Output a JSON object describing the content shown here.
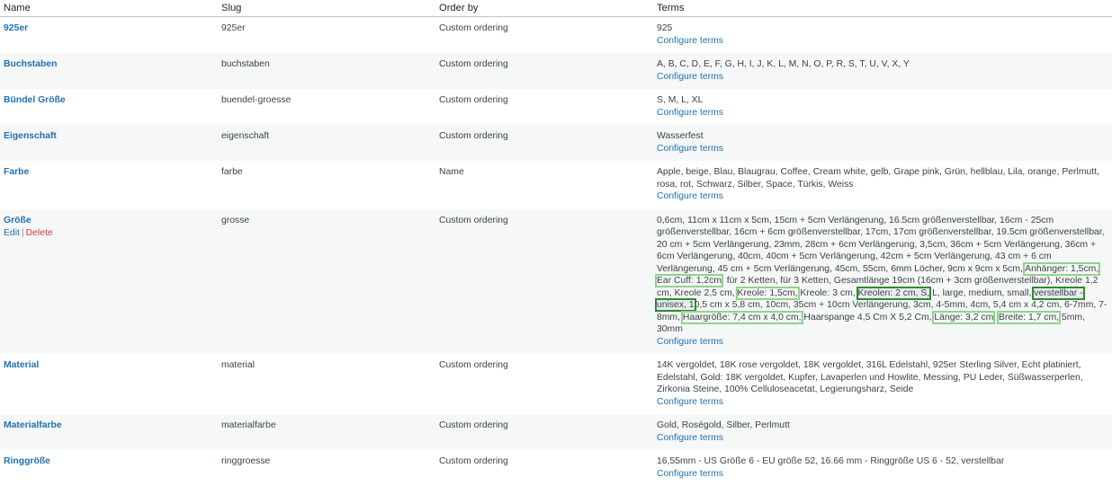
{
  "headers": {
    "name": "Name",
    "slug": "Slug",
    "order_by": "Order by",
    "terms": "Terms"
  },
  "configure_label": "Configure terms",
  "actions": {
    "edit": "Edit",
    "sep": "|",
    "delete": "Delete"
  },
  "rows": [
    {
      "name": "925er",
      "slug": "925er",
      "order_by": "Custom ordering",
      "terms": "925"
    },
    {
      "name": "Buchstaben",
      "slug": "buchstaben",
      "order_by": "Custom ordering",
      "terms": "A, B, C, D, E, F, G, H, I, J, K, L, M, N, O, P, R, S, T, U, V, X, Y"
    },
    {
      "name": "Bündel Größe",
      "slug": "buendel-groesse",
      "order_by": "Custom ordering",
      "terms": "S, M, L, XL"
    },
    {
      "name": "Eigenschaft",
      "slug": "eigenschaft",
      "order_by": "Custom ordering",
      "terms": "Wasserfest"
    },
    {
      "name": "Farbe",
      "slug": "farbe",
      "order_by": "Name",
      "terms": "Apple, beige, Blau, Blaugrau, Coffee, Cream white, gelb, Grape pink, Grün, hellblau, Lila, orange, Perlmutt, rosa, rot, Schwarz, Silber, Space, Türkis, Weiss"
    },
    {
      "name": "Größe",
      "slug": "grosse",
      "order_by": "Custom ordering",
      "terms_parts": [
        "0,6cm, 11cm x 11cm x 5cm, 15cm + 5cm Verlängerung, 16.5cm größenverstellbar, 16cm - 25cm größenverstellbar, 16cm + 6cm größenverstellbar, 17cm, 17cm größenverstellbar, 19.5cm größenverstellbar, 20 cm + 5cm Verlängerung, 23mm, 28cm + 6cm Verlängerung, 3,5cm, 36cm + 5cm Verlängerung, 36cm + 6cm Verlängerung, 40cm, 40cm + 5cm Verlängerung, 42cm + 5cm Verlängerung, 43 cm + 6 cm Verlängerung, 45 cm + 5cm Verlängerung, 45cm, 55cm, 6mm Löcher, 9cm x 9cm x 5cm, ",
        "Anhänger: 1,5cm,",
        " ",
        "Ear Cuff: 1,2cm",
        ", für 2 Ketten, für 3 Ketten, Gesamtlänge 19cm (16cm + 3cm größenverstellbar), Kreole 1,2 cm, Kreole 2,5 cm, ",
        "Kreole: 1,5cm,",
        " Kreole: 3 cm, ",
        "Kreolen: 2 cm, S,",
        " L, large, medium, small, ",
        "verstellbar - unisex, 1",
        "0,5 cm x 5,8 cm, 10cm, 35cm + 10cm Verlängerung, 3cm, 4-5mm, 4cm, 5,4 cm x 4,2 cm, 6-7mm, 7-8mm, ",
        "Haargröße: 7,4 cm x 4,0 cm,",
        " Haarspange 4,5 Cm X 5,2 Cm, ",
        "Länge: 3,2 cm",
        ", ",
        "Breite: 1,7 cm,",
        " 5mm, 30mm"
      ]
    },
    {
      "name": "Material",
      "slug": "material",
      "order_by": "Custom ordering",
      "terms": "14K vergoldet, 18K rose vergoldet, 18K vergoldet, 316L Edelstahl, 925er Sterling Silver, Echt platiniert, Edelstahl, Gold: 18K vergoldet, Kupfer, Lavaperlen und Howlite, Messing, PU Leder, Süßwasserperlen, Zirkonia Steine, 100% Celluloseacetat, Legierungsharz, Seide"
    },
    {
      "name": "Materialfarbe",
      "slug": "materialfarbe",
      "order_by": "Custom ordering",
      "terms": "Gold, Roségold, Silber, Perlmutt"
    },
    {
      "name": "Ringgröße",
      "slug": "ringgroesse",
      "order_by": "Custom ordering",
      "terms": "16,55mm - US Größe 6 - EU größe 52, 16.66 mm - Ringgröße US 6 - 52, verstellbar"
    }
  ],
  "colors": {
    "link": "#2271b1",
    "delete": "#d63638",
    "alt_row": "#f6f7f7",
    "highlight": "#8fd48a",
    "highlight_dark": "#2e8b2e"
  }
}
